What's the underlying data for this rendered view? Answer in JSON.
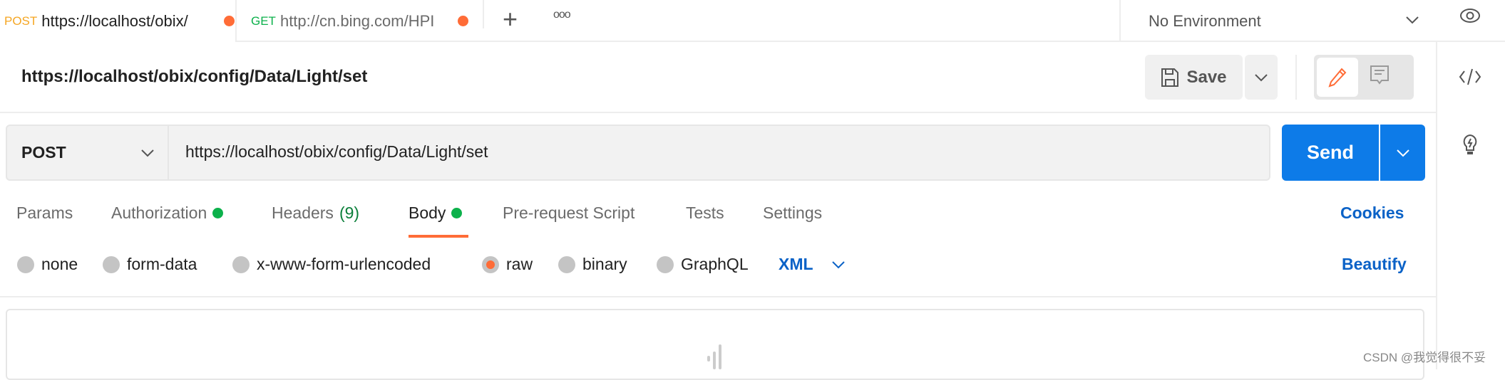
{
  "tabs": [
    {
      "method": "POST",
      "url": "https://localhost/obix/",
      "method_color": "#f5a623"
    },
    {
      "method": "GET",
      "url": "http://cn.bing.com/HPI",
      "method_color": "#0cb14b"
    }
  ],
  "environment": {
    "selected": "No Environment"
  },
  "request": {
    "title": "https://localhost/obix/config/Data/Light/set",
    "method": "POST",
    "url": "https://localhost/obix/config/Data/Light/set",
    "save_label": "Save",
    "send_label": "Send"
  },
  "request_tabs": [
    {
      "label": "Params"
    },
    {
      "label": "Authorization",
      "dot": true
    },
    {
      "label": "Headers",
      "count": "(9)"
    },
    {
      "label": "Body",
      "dot": true,
      "active": true
    },
    {
      "label": "Pre-request Script"
    },
    {
      "label": "Tests"
    },
    {
      "label": "Settings"
    }
  ],
  "cookies_label": "Cookies",
  "body_types": [
    {
      "label": "none"
    },
    {
      "label": "form-data"
    },
    {
      "label": "x-www-form-urlencoded"
    },
    {
      "label": "raw",
      "selected": true
    },
    {
      "label": "binary"
    },
    {
      "label": "GraphQL"
    }
  ],
  "raw_format": "XML",
  "beautify_label": "Beautify",
  "watermark": "CSDN @我觉得很不妥",
  "colors": {
    "accent": "#ff6c37",
    "primary": "#0d7be8",
    "green": "#0cb14b",
    "link": "#0b62c7"
  }
}
